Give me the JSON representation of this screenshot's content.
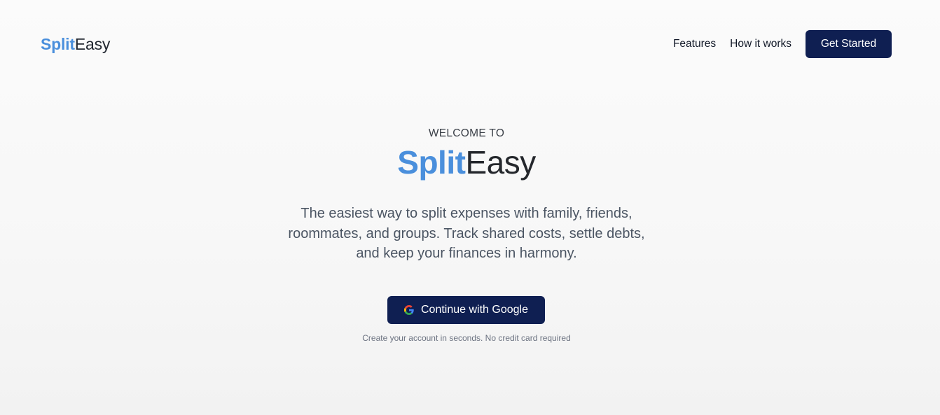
{
  "header": {
    "logo": {
      "part1": "Split",
      "part2": "Easy"
    },
    "nav": [
      {
        "label": "Features"
      },
      {
        "label": "How it works"
      }
    ],
    "cta_label": "Get Started"
  },
  "hero": {
    "eyebrow": "WELCOME TO",
    "title": {
      "part1": "Split",
      "part2": "Easy"
    },
    "tagline": "The easiest way to split expenses with family, friends, roommates, and groups. Track shared costs, settle debts, and keep your finances in harmony.",
    "google_button_label": "Continue with Google",
    "google_icon": "google-icon",
    "note": "Create your account in seconds. No credit card required"
  },
  "colors": {
    "brand_blue": "#4a8fdc",
    "navy": "#0f1f52",
    "text_dark": "#24272c",
    "text_muted": "#4b5563"
  }
}
